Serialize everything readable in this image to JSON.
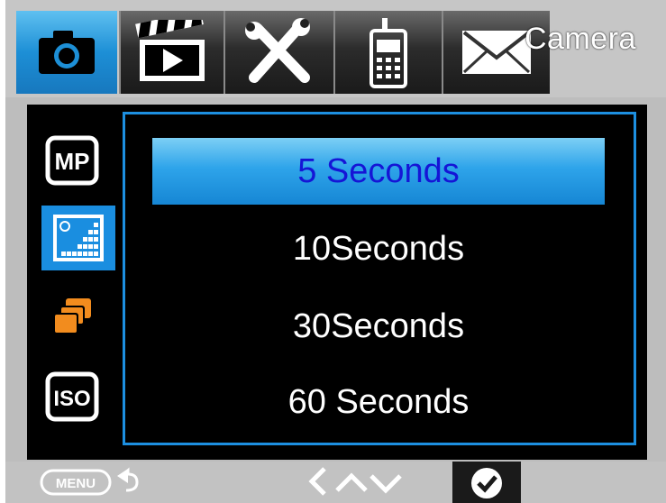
{
  "header": {
    "title": "Camera",
    "tabs": [
      {
        "icon": "camera-icon",
        "active": true
      },
      {
        "icon": "video-clapper-icon",
        "active": false
      },
      {
        "icon": "tools-icon",
        "active": false
      },
      {
        "icon": "walkie-talkie-icon",
        "active": false
      },
      {
        "icon": "envelope-icon",
        "active": false
      }
    ]
  },
  "sidebar": {
    "items": [
      {
        "icon": "mp-resolution-icon",
        "label": "MP"
      },
      {
        "icon": "interval-icon",
        "selected": true
      },
      {
        "icon": "burst-icon"
      },
      {
        "icon": "iso-icon",
        "label": "ISO"
      }
    ]
  },
  "options": [
    {
      "label": "5 Seconds",
      "selected": true
    },
    {
      "label": "10Seconds"
    },
    {
      "label": "30Seconds"
    },
    {
      "label": "60 Seconds"
    }
  ],
  "footer": {
    "menu_label": "MENU"
  },
  "colors": {
    "accent": "#1d8fe0",
    "selected_text": "#1515d6"
  }
}
